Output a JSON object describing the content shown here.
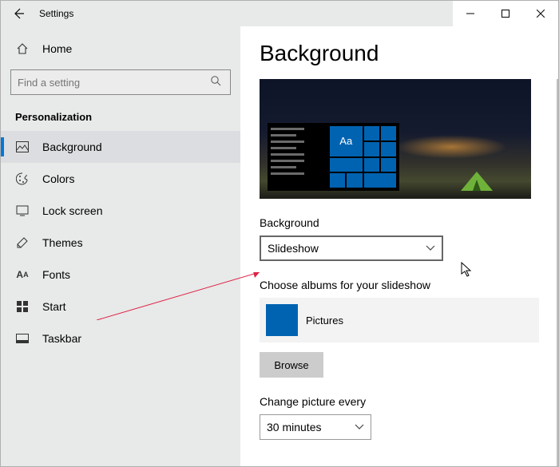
{
  "window": {
    "title": "Settings"
  },
  "sidebar": {
    "home_label": "Home",
    "search_placeholder": "Find a setting",
    "section": "Personalization",
    "items": [
      {
        "label": "Background"
      },
      {
        "label": "Colors"
      },
      {
        "label": "Lock screen"
      },
      {
        "label": "Themes"
      },
      {
        "label": "Fonts"
      },
      {
        "label": "Start"
      },
      {
        "label": "Taskbar"
      }
    ]
  },
  "page": {
    "title": "Background",
    "preview_tile_text": "Aa",
    "background_label": "Background",
    "background_value": "Slideshow",
    "albums_label": "Choose albums for your slideshow",
    "album_name": "Pictures",
    "browse_label": "Browse",
    "interval_label": "Change picture every",
    "interval_value": "30 minutes"
  }
}
